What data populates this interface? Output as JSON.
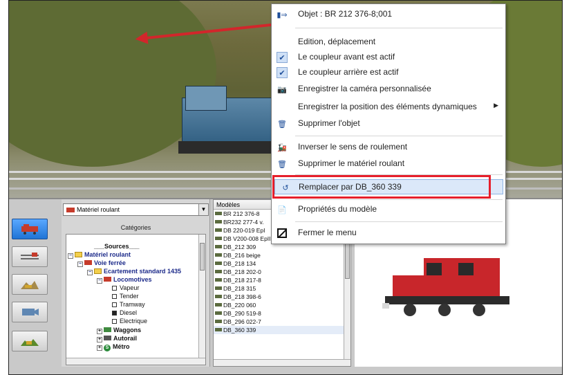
{
  "menu": {
    "header": "Objet : BR 212 376-8;001",
    "items": [
      {
        "label": "Edition, déplacement",
        "icon": "none"
      },
      {
        "label": "Le coupleur avant est actif",
        "icon": "check-icon"
      },
      {
        "label": "Le coupleur arrière est actif",
        "icon": "check-icon"
      },
      {
        "label": "Enregistrer la caméra personnalisée",
        "icon": "camera-icon"
      },
      {
        "label": "Enregistrer la position des éléments dynamiques",
        "icon": "none"
      },
      {
        "label": "Supprimer l'objet",
        "icon": "trash-icon"
      },
      {
        "label": "Inverser le sens de roulement",
        "icon": "locomotive-icon"
      },
      {
        "label": "Supprimer le matériel roulant",
        "icon": "trash-icon"
      },
      {
        "label": "Remplacer par DB_360 339",
        "icon": "replace-icon"
      },
      {
        "label": "Propriétés du modèle",
        "icon": "properties-icon"
      },
      {
        "label": "Fermer le menu",
        "icon": "close-menu-icon"
      }
    ]
  },
  "left_panel": {
    "combo_value": "Matériel roulant",
    "categories_label": "Catégories"
  },
  "tree": {
    "sources": "___Sources___",
    "materiel_roulant": "Matériel roulant",
    "voie_ferree": "Voie ferrée",
    "ecartement": "Ecartement standard 1435",
    "locomotives": "Locomotives",
    "vapeur": "Vapeur",
    "tender": "Tender",
    "tramway": "Tramway",
    "diesel": "Diesel",
    "electrique": "Electrique",
    "waggons": "Waggons",
    "autorail": "Autorail",
    "metro": "Métro"
  },
  "models": {
    "header": "Modèles",
    "rows": [
      "BR 212 376-8",
      "BR232 277-4 v.",
      "DB 220-019 EpI",
      "DB V200-008 EpIII",
      "DB_212 309",
      "DB_216 beige",
      "DB_218 134",
      "DB_218 202-0",
      "DB_218 217-8",
      "DB_218 315",
      "DB_218 398-6",
      "DB_220 060",
      "DB_290 519-8",
      "DB_296 022-7",
      "DB_360 339"
    ]
  },
  "colors": {
    "highlight_box": "#e61f2b",
    "accent": "#1f74d6"
  }
}
